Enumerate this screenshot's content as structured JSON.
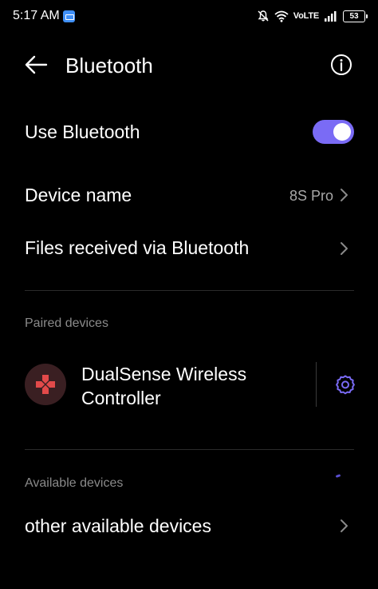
{
  "status_bar": {
    "time": "5:17 AM",
    "network_label": "VoLTE",
    "battery_level": "53",
    "icons": [
      "app-notification-icon",
      "mute-icon",
      "wifi-icon",
      "signal-icon",
      "battery-icon"
    ]
  },
  "header": {
    "title": "Bluetooth",
    "back_icon": "back-arrow-icon",
    "info_icon": "info-icon"
  },
  "settings": {
    "use_bluetooth": {
      "label": "Use Bluetooth",
      "enabled": true
    },
    "device_name": {
      "label": "Device name",
      "value": "8S Pro"
    },
    "files_received": {
      "label": "Files received via Bluetooth"
    }
  },
  "paired": {
    "header": "Paired devices",
    "devices": [
      {
        "name": "DualSense Wireless Controller",
        "icon": "gamepad-icon",
        "settings_icon": "gear-icon"
      }
    ]
  },
  "available": {
    "header": "Available devices",
    "other_label": "other available devices"
  },
  "colors": {
    "background": "#000000",
    "accent": "#7a6bf5",
    "secondary_text": "#a8a8a8",
    "section_header": "#8a8a8a",
    "device_icon": "#e24a4a",
    "device_avatar_bg": "#3a1f22"
  }
}
